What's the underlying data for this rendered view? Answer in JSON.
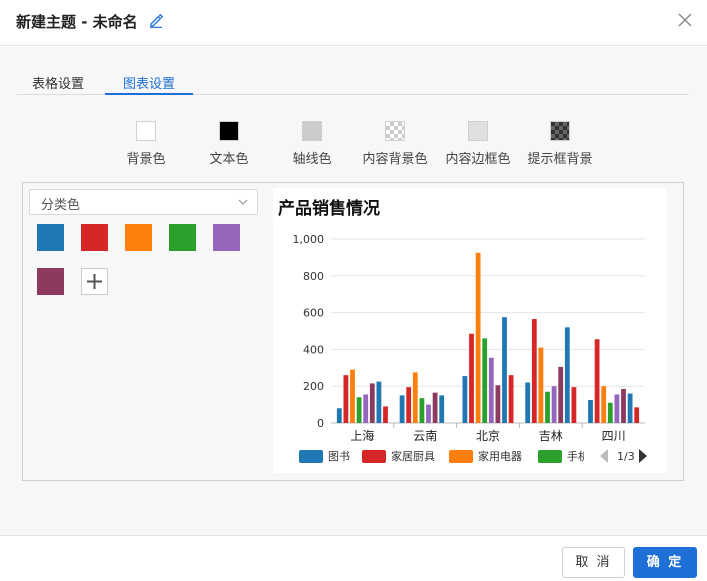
{
  "dialog": {
    "title": "新建主题 - 未命名"
  },
  "tabs": [
    {
      "label": "表格设置"
    },
    {
      "label": "图表设置"
    }
  ],
  "appearance": {
    "items": [
      {
        "label": "背景色",
        "color": "#ffffff"
      },
      {
        "label": "文本色",
        "color": "#000000"
      },
      {
        "label": "轴线色",
        "color": "#cccccc"
      },
      {
        "label": "内容背景色",
        "color": "transparent"
      },
      {
        "label": "内容边框色",
        "color": "#e0e0e0"
      },
      {
        "label": "提示框背景",
        "color": "#333333"
      }
    ]
  },
  "palette": {
    "mode": "分类色",
    "colors": [
      "#1f77b4",
      "#d62728",
      "#ff7f0e",
      "#2ca02c",
      "#9467bd",
      "#8c3a60"
    ]
  },
  "chart_data": {
    "type": "bar",
    "title": "产品销售情况",
    "categories": [
      "上海",
      "云南",
      "北京",
      "吉林",
      "四川"
    ],
    "ylim": [
      0,
      1000
    ],
    "yticks": [
      "0",
      "200",
      "400",
      "600",
      "800",
      "1,000"
    ],
    "series": [
      {
        "name": "图书",
        "color": "#1f77b4",
        "values": [
          80,
          150,
          255,
          220,
          125
        ]
      },
      {
        "name": "家居厨具",
        "color": "#d62728",
        "values": [
          260,
          195,
          485,
          565,
          455
        ]
      },
      {
        "name": "家用电器",
        "color": "#ff7f0e",
        "values": [
          290,
          275,
          925,
          410,
          200
        ]
      },
      {
        "name": "手机",
        "color": "#2ca02c",
        "values": [
          140,
          135,
          460,
          170,
          110
        ]
      },
      {
        "name": "",
        "color": "#9467bd",
        "values": [
          155,
          100,
          355,
          200,
          155
        ]
      },
      {
        "name": "",
        "color": "#8c3a60",
        "values": [
          215,
          165,
          205,
          305,
          185
        ]
      },
      {
        "name": "",
        "color": "#1f77b4",
        "values": [
          225,
          150,
          575,
          520,
          160
        ]
      },
      {
        "name": "",
        "color": "#d62728",
        "values": [
          90,
          0,
          260,
          195,
          85
        ]
      }
    ],
    "legend": {
      "position": "bottom",
      "page": "1/3",
      "visible": [
        "图书",
        "家居厨具",
        "家用电器",
        "手机"
      ]
    }
  },
  "footer": {
    "cancel": "取 消",
    "ok": "确 定"
  }
}
